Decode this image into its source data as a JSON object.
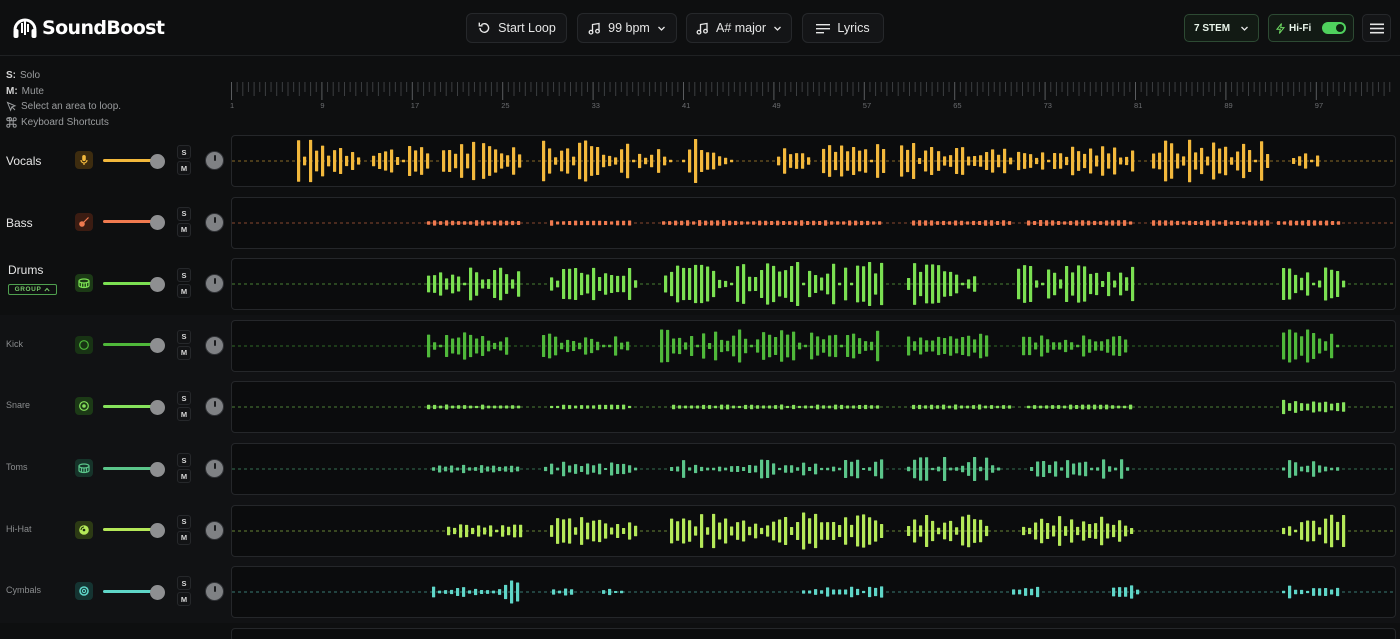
{
  "app": {
    "name": "SoundBoost"
  },
  "toolbar": {
    "start_loop": "Start Loop",
    "bpm": "99 bpm",
    "key": "A# major",
    "lyrics": "Lyrics",
    "stem_select": "7 STEM",
    "hifi_label": "Hi-Fi",
    "hifi_enabled": true
  },
  "help": {
    "solo_key": "S:",
    "solo_text": "Solo",
    "mute_key": "M:",
    "mute_text": "Mute",
    "loop_hint": "Select an area to loop.",
    "shortcuts": "Keyboard Shortcuts"
  },
  "ruler": {
    "labels": [
      "1",
      "9",
      "17",
      "25",
      "33",
      "41",
      "49",
      "57",
      "65",
      "73",
      "81",
      "89",
      "97"
    ]
  },
  "track_controls": {
    "solo": "S",
    "mute": "M"
  },
  "group": {
    "badge_label": "GROUP",
    "badge_icon": "chevron-up-icon"
  },
  "tracks": [
    {
      "name": "Vocals",
      "icon": "microphone-icon",
      "color": "#f2b83c",
      "icon_bg": "#3d2c0f",
      "volume": 0.85,
      "is_sub": false
    },
    {
      "name": "Bass",
      "icon": "guitar-icon",
      "color": "#f07a4f",
      "icon_bg": "#3b1c12",
      "volume": 0.85,
      "is_sub": false
    },
    {
      "name": "Drums",
      "icon": "drum-icon",
      "color": "#7be052",
      "icon_bg": "#1c3a16",
      "volume": 0.85,
      "is_sub": false
    },
    {
      "name": "Kick",
      "icon": "kick-drum-icon",
      "color": "#4fb83a",
      "icon_bg": "#183314",
      "volume": 0.85,
      "is_sub": true
    },
    {
      "name": "Snare",
      "icon": "snare-icon",
      "color": "#86e25c",
      "icon_bg": "#1c3a16",
      "volume": 0.85,
      "is_sub": true
    },
    {
      "name": "Toms",
      "icon": "toms-icon",
      "color": "#5bc58a",
      "icon_bg": "#16342a",
      "volume": 0.85,
      "is_sub": true
    },
    {
      "name": "Hi-Hat",
      "icon": "hi-hat-icon",
      "color": "#b4e858",
      "icon_bg": "#2c3a14",
      "volume": 0.85,
      "is_sub": true
    },
    {
      "name": "Cymbals",
      "icon": "cymbal-icon",
      "color": "#5fd6c8",
      "icon_bg": "#153432",
      "volume": 0.85,
      "is_sub": true
    }
  ]
}
